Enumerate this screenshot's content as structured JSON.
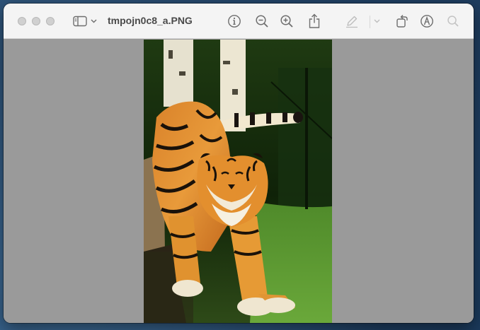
{
  "window": {
    "title": "tmpojn0c8_a.PNG"
  },
  "toolbar": {
    "icons": [
      "sidebar-icon",
      "chevron-down-icon",
      "info-icon",
      "zoom-out-icon",
      "zoom-in-icon",
      "share-icon",
      "markup-pen-icon",
      "chevron-down-icon",
      "rotate-icon",
      "annotate-icon",
      "search-icon"
    ]
  },
  "image": {
    "subject": "tiger"
  },
  "colors": {
    "titlebar": "#f4f4f4",
    "canvas": "#9a9a9a",
    "icon": "#6e6e6e"
  }
}
